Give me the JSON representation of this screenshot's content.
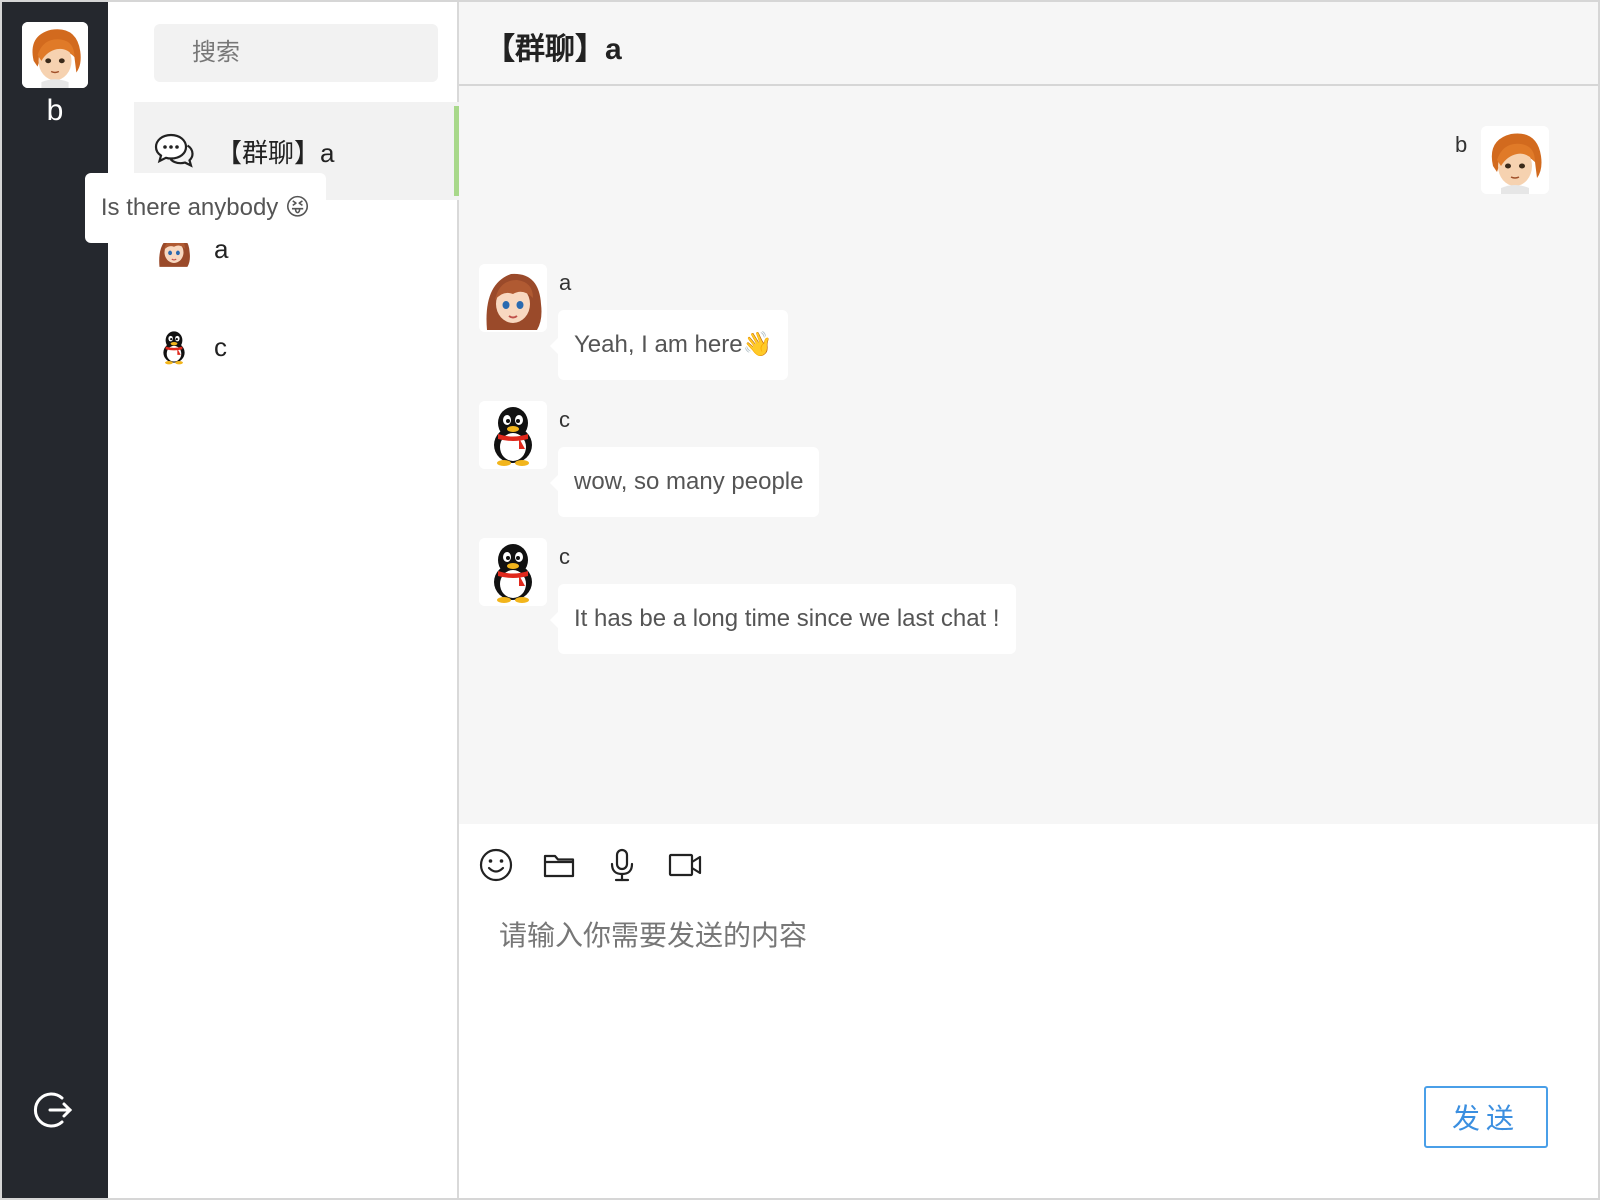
{
  "current_user": {
    "name": "b",
    "avatar": "orange-haired-boy-avatar"
  },
  "rail": {
    "logout_icon": "logout-icon"
  },
  "search": {
    "placeholder": "搜索",
    "value": ""
  },
  "contacts": [
    {
      "label": "【群聊】a",
      "icon": "chat-bubbles-icon",
      "active": true
    },
    {
      "label": "a",
      "icon": "brown-haired-girl-avatar",
      "active": false
    },
    {
      "label": "c",
      "icon": "penguin-avatar",
      "active": false
    }
  ],
  "chat": {
    "title": "【群聊】a",
    "messages": [
      {
        "sender": "b",
        "text": "Is there anybody 😝",
        "side": "right",
        "avatar": "orange-haired-boy-avatar"
      },
      {
        "sender": "a",
        "text": "Yeah, I am here👋",
        "side": "left",
        "avatar": "brown-haired-girl-avatar"
      },
      {
        "sender": "c",
        "text": "wow, so many people",
        "side": "left",
        "avatar": "penguin-avatar"
      },
      {
        "sender": "c",
        "text": "It has be a long time since we last chat !",
        "side": "left",
        "avatar": "penguin-avatar"
      }
    ]
  },
  "composer": {
    "tools": [
      "emoji-icon",
      "folder-icon",
      "microphone-icon",
      "video-icon"
    ],
    "placeholder": "请输入你需要发送的内容",
    "value": "",
    "send_label": "发送"
  },
  "colors": {
    "rail_bg": "#25282e",
    "active_indicator": "#a8d88a",
    "send_border": "#4a9fe8",
    "chat_bg": "#f6f6f6"
  }
}
